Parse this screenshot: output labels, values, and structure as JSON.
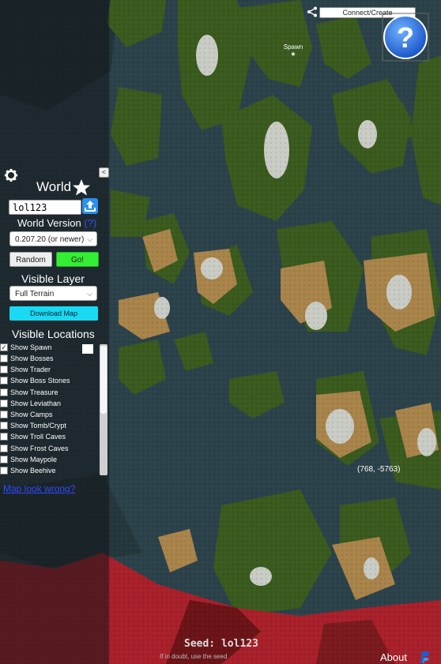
{
  "header": {
    "connect_label": "Connect/Create",
    "help_icon": "question-mark-icon",
    "share_icon": "share-icon"
  },
  "sidebar": {
    "world_title": "World",
    "seed_value": "lol123",
    "version_label": "World Version",
    "version_help": "(?)",
    "version_selected": "0.207.20 (or newer)",
    "random_label": "Random",
    "go_label": "Go!",
    "layer_label": "Visible Layer",
    "layer_selected": "Full Terrain",
    "download_label": "Download Map",
    "locations_label": "Visible Locations",
    "locations": [
      {
        "label": "Show Spawn",
        "checked": true
      },
      {
        "label": "Show Bosses",
        "checked": false
      },
      {
        "label": "Show Trader",
        "checked": false
      },
      {
        "label": "Show Boss Stones",
        "checked": false
      },
      {
        "label": "Show Treasure",
        "checked": false
      },
      {
        "label": "Show Leviathan",
        "checked": false
      },
      {
        "label": "Show Camps",
        "checked": false
      },
      {
        "label": "Show Tomb/Crypt",
        "checked": false
      },
      {
        "label": "Show Troll Caves",
        "checked": false
      },
      {
        "label": "Show Frost Caves",
        "checked": false
      },
      {
        "label": "Show Maypole",
        "checked": false
      },
      {
        "label": "Show Beehive",
        "checked": false
      }
    ],
    "map_wrong_link": "Map look wrong?"
  },
  "map": {
    "spawn_label": "Spawn",
    "coords": "(768, -5763)"
  },
  "footer": {
    "seed_text": "Seed: lol123",
    "hint_text": "If in doubt, use the seed",
    "about_label": "About"
  },
  "colors": {
    "go": "#33ee33",
    "download": "#1ad9f2",
    "upload": "#2a8ff0",
    "help": "#2a6fe0",
    "water": "#2e4750",
    "forest": "#3c5a1c",
    "plains": "#b08a4a",
    "mountain": "#cfd2cc",
    "ashlands": "#b0202a"
  }
}
